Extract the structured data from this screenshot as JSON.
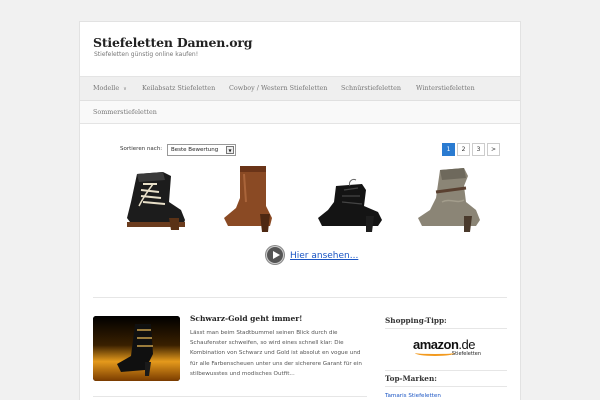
{
  "header": {
    "site_title": "Stiefeletten Damen.org",
    "site_description": "Stiefeletten günstig online kaufen!"
  },
  "nav": {
    "items": [
      {
        "label": "Modelle",
        "has_dropdown": true
      },
      {
        "label": "Keilabsatz Stiefeletten"
      },
      {
        "label": "Cowboy / Western Stiefeletten"
      },
      {
        "label": "Schnürstiefeletten"
      },
      {
        "label": "Winterstiefeletten"
      },
      {
        "label": "Sommerstiefeletten"
      }
    ]
  },
  "shop": {
    "sort_label": "Sortieren nach:",
    "sort_value": "Beste Bewertung",
    "pages": [
      "1",
      "2",
      "3",
      ">"
    ],
    "active_page": "1",
    "products": [
      {
        "icon": "black-lace-up-boot"
      },
      {
        "icon": "brown-leather-boot"
      },
      {
        "icon": "black-lace-ankle-boot"
      },
      {
        "icon": "grey-slouch-boot"
      }
    ],
    "cta_label": "Hier ansehen..."
  },
  "post": {
    "title": "Schwarz-Gold geht immer!",
    "excerpt": "Lässt man beim Stadtbummel seinen Blick durch die Schaufenster schweifen, so wird eines schnell klar: Die Kombination von Schwarz und Gold ist absolut en vogue und für alle Farbenscheuen unter uns der sicherere Garant für ein stilbewusstes und modisches Outfit..."
  },
  "sidebar": {
    "shopping_tip_title": "Shopping-Tipp:",
    "amazon_word": "amazon",
    "amazon_tld": ".de",
    "amazon_sub": "Stiefeletten",
    "brands_title": "Top-Marken:",
    "brand_link": "Tamaris Stiefeletten"
  },
  "colors": {
    "accent": "#2a7bd1",
    "link": "#1a55c4",
    "amazon_orange": "#f29a1f"
  }
}
